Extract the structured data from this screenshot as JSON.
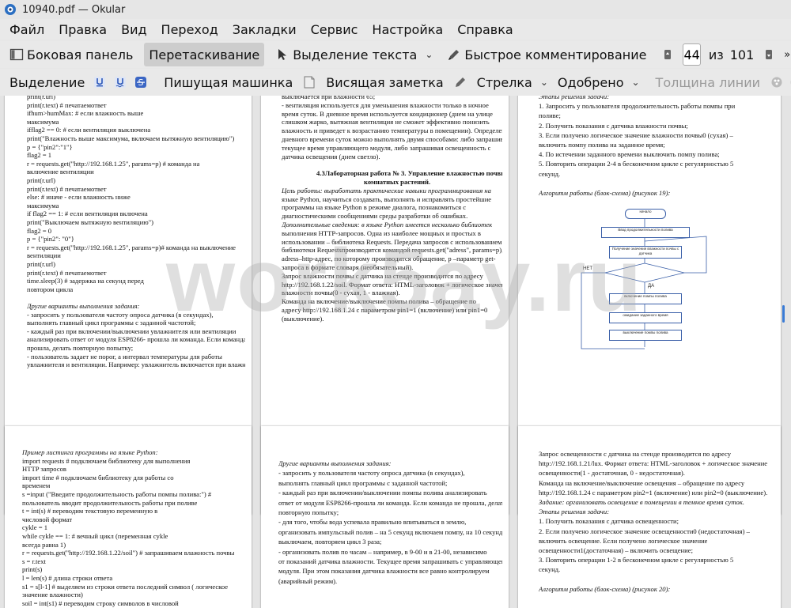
{
  "window": {
    "title": "10940.pdf — Okular"
  },
  "menu": [
    "Файл",
    "Правка",
    "Вид",
    "Переход",
    "Закладки",
    "Сервис",
    "Настройка",
    "Справка"
  ],
  "toolbar1": {
    "sidebar": "Боковая панель",
    "drag": "Перетаскивание",
    "text_select": "Выделение текста",
    "quick_comment": "Быстрое комментирование",
    "page_current": "44",
    "page_of": "из",
    "page_total": "101"
  },
  "toolbar2": {
    "highlight": "Выделение",
    "typewriter": "Пишущая машинка",
    "sticky": "Висящая заметка",
    "arrow": "Стрелка",
    "approved": "Одобрено",
    "line_width": "Толщина линии"
  },
  "watermark": "work5ay.ru",
  "pages": {
    "p1": {
      "number": "43",
      "lines": [
        "print(r.url)",
        "print(r.text)                                    # печатаемответ",
        "ifhum>humMax:                                    # если влажность выше",
        "максимума",
        "ifflag2 == 0:                      # если вентиляция выключена",
        "print(\"Влажность выше максимума, включаем вытяжную вентиляцию\")",
        "p = {\"pin2\":\"1\"}",
        "flag2 = 1",
        "r = requests.get(\"http://192.168.1.25\", params=p)      #    команда на",
        "включение вентиляции",
        "print(r.url)",
        "print(r.text)                              # печатаемответ",
        "else:                                      # иначе - если влажность ниже",
        "максимума",
        "if flag2 == 1:                             # если вентиляция включена",
        "print(\"Выключаем вытяжную вентиляцию\")",
        "flag2 = 0",
        "p = {\"pin2\": \"0\"}",
        "r = requests.get(\"http://192.168.1.25\", params=p)# команда на выключение",
        "вентиляции",
        "print(r.url)",
        "print(r.text)                              # печатаемответ",
        "time.sleep(3)                              # задержка  на секунд перед",
        "повтором цикла",
        "",
        "Другие варианты выполнения задания:",
        "- запросить у пользователя частоту опроса датчика (в секундах),",
        "выполнять главный цикл программы с заданной частотой;",
        "- каждый раз при включении/выключении увлажнителя или вентиляции",
        "анализировать ответ от модуля ESP8266- прошла ли команда. Если команда не",
        "прошла, делать повторную попытку;",
        "- пользователь задает не порог, а интервал температуры для работы",
        "увлажнителя и вентиляции. Например: увлажнитель включается при влажности"
      ]
    },
    "p2": {
      "number": "44",
      "lines": [
        "выключается при влажности 65;",
        "- вентиляция используется для уменьшения влажности только в ночное",
        "время суток. В дневное время используется кондиционер (днем на улице",
        "слишком жарко, вытяжная вентиляция не сможет эффективно понизить",
        "влажность и приведет к возрастанию температуры в помещении). Определение",
        "дневного времени суток можно выполнять двумя способами: либо запрашивая",
        "текущее время управляющего модуля, либо запрашивая освещенность с",
        "датчика освещения (днем светло).",
        "",
        "4.3Лабораторная работа № 3. Управление влажностью почвы",
        "комнатных растений.",
        "Цель работы: выработать практические навыки программирования на",
        "языке Python, научиться создавать, выполнять и исправлять простейшие",
        "программы на языке Python в режиме диалога, познакомиться с",
        "диагностическими сообщениями среды разработки об ошибках.",
        "Дополнительные сведения: в языке Python имеется несколько библиотек",
        "выполнения HTTP-запросов. Одна из наиболее мощных и простых в",
        "использовании – библиотека Requests. Передача запросов с использованием",
        "библиотеки Requestsпроизводится командой requests.get(\"adress\", params=p), где",
        "adress–http-адрес, по которому производится обращение, p –параметр get-",
        "запроса в формате словаря (необязательный).",
        "Запрос влажности почвы с датчика на стенде производится по адресу",
        "http://192.168.1.22/soil. Формат ответа: HTML-заголовок + логическое значение",
        "влажности почвы(0 - сухая, 1 - влажная).",
        "Команда на включение/выключение помпы полива – обращение по",
        "адресу http://192.168.1.24 с параметром pin1=1 (включение) или pin1=0",
        "(выключение)."
      ]
    },
    "p3": {
      "number": "45",
      "lines": [
        "Этапы решения задачи:",
        "1. Запросить у пользователя продолжительность работы помпы при",
        "поливе;",
        "2. Получить показания с датчика влажности почвы;",
        "3. Если получено логическое значение влажности почвы0 (сухая) –",
        "включить помпу полива на заданное время;",
        "4. По истечении заданного времени выключить помпу полива;",
        "5. Повторить операции 2-4 в бесконечном цикле с регулярностью 5",
        "секунд.",
        "",
        "Алгоритм работы (блок-схема) (рисунок 19):",
        "Рисунок 19 – Блок-схема программы лабораторной работы № 3."
      ],
      "flow": {
        "start": "начало",
        "input": "Ввод продолжительности полива",
        "query": "Получение значения влажности почвы с датчика",
        "no": "НЕТ",
        "yes": "ДА",
        "pump_on": "включение помпы полива",
        "delay": "ожидание заданного время",
        "pump_off": "выключение помпы полива"
      }
    },
    "p4": {
      "number": "",
      "lines": [
        "Пример листинга программы на языке Python:",
        "import requests                    # подключаем библиотеку для выполнения",
        "HTTP запросов",
        "import time                        # подключаем библиотеку для работы со",
        "временем",
        "s =input (\"Введите продолжительность работы помпы полива:\")     #",
        "пользователь вводит продолжительность работы при поливе",
        "t = int(s)                         # переводим текстовую переменную в",
        "числовой формат",
        "cykle = 1",
        "while cykle == 1:                  # вечный цикл (переменная cykle",
        "всегда равна 1)",
        "r = requests.get(\"http://192.168.1.22/soil\")  # запрашиваем влажность почвы",
        "s = r.text",
        "print(s)",
        "l = len(s)                   # длина строки ответа",
        "s1 = s[l-1]   # выделяем из строки ответа последний символ ( логическое",
        "значение влажности)",
        "soil = int(s1)               # переводим строку символов в числовой"
      ]
    },
    "p5": {
      "number": "",
      "lines": [
        "Другие варианты выполнения задания:",
        "- запросить у пользователя частоту опроса датчика (в секундах),",
        "выполнять главный цикл программы с заданной частотой;",
        "- каждый раз при включении/выключении помпы полива анализировать",
        "ответ от модуля ESP8266-прошла ли команда. Если команда не прошла, делать",
        "повторную попытку;",
        "- для того, чтобы вода успевала правильно впитываться в землю,",
        "организовать импульсный полив – на 5 секунд включаем помпу, на 10 секунд",
        "выключаем, повторяем цикл 3 раза;",
        "- организовать полив по часам – например, в 9-00 и в 21-00, независимо",
        "от показаний датчика влажности. Текущее время запрашивать с управляющего",
        "модуля. При этом показания датчика влажности все равно контролируем",
        "(аварийный режим)."
      ]
    },
    "p6": {
      "number": "",
      "lines": [
        "Запрос освещенности с датчика на стенде производится по адресу",
        "http://192.168.1.21/lux. Формат ответа: HTML-заголовок + логическое значение",
        "освещенности(1 - достаточная, 0 - недостаточная).",
        "Команда на включение/выключение освещения – обращение по адресу",
        "http://192.168.1.24 с параметром pin2=1 (включение) или pin2=0 (выключение).",
        "Задание: организовать освещение в помещении в темное время суток.",
        "Этапы решения задачи:",
        "1. Получить показания с датчика освещенности;",
        "2. Если получено логическое значение освещенности0 (недостаточная) –",
        "включить освещение. Если получено логическое значение",
        "освещенности1(достаточная) – включить освещение;",
        "3. Повторить операции 1-2 в бесконечном цикле с регулярностью 5",
        "секунд.",
        "",
        "Алгоритм работы (блок-схема) (рисунок 20):"
      ]
    }
  }
}
